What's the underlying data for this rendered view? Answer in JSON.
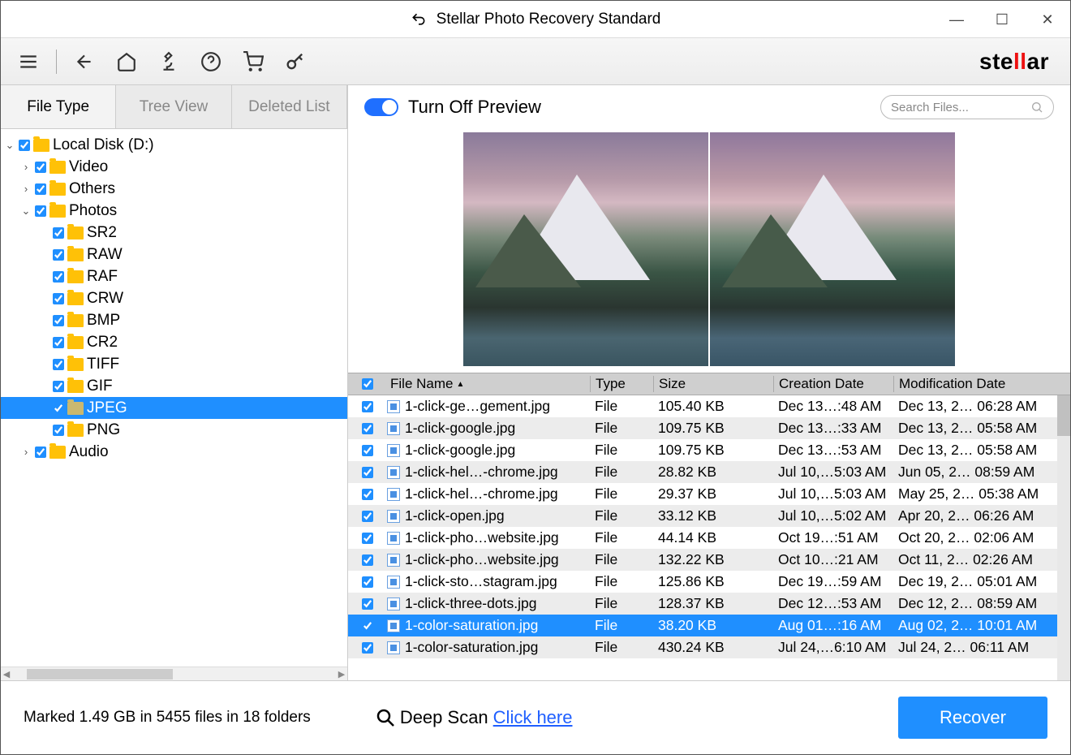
{
  "title": "Stellar Photo Recovery Standard",
  "brand": {
    "pre": "ste",
    "mid": "ll",
    "post": "ar"
  },
  "tabs": [
    "File Type",
    "Tree View",
    "Deleted List"
  ],
  "tree": {
    "root": "Local Disk (D:)",
    "items": [
      "Video",
      "Others",
      "Photos",
      "Audio"
    ],
    "photos_children": [
      "SR2",
      "RAW",
      "RAF",
      "CRW",
      "BMP",
      "CR2",
      "TIFF",
      "GIF",
      "JPEG",
      "PNG"
    ]
  },
  "toggle_label": "Turn Off Preview",
  "search_placeholder": "Search Files...",
  "columns": [
    "File Name",
    "Type",
    "Size",
    "Creation Date",
    "Modification Date"
  ],
  "files": [
    {
      "name": "1-click-ge…gement.jpg",
      "type": "File",
      "size": "105.40 KB",
      "cdate": "Dec 13…:48 AM",
      "mdate": "Dec 13, 2… 06:28 AM"
    },
    {
      "name": "1-click-google.jpg",
      "type": "File",
      "size": "109.75 KB",
      "cdate": "Dec 13…:33 AM",
      "mdate": "Dec 13, 2… 05:58 AM"
    },
    {
      "name": "1-click-google.jpg",
      "type": "File",
      "size": "109.75 KB",
      "cdate": "Dec 13…:53 AM",
      "mdate": "Dec 13, 2… 05:58 AM"
    },
    {
      "name": "1-click-hel…-chrome.jpg",
      "type": "File",
      "size": "28.82 KB",
      "cdate": "Jul 10,…5:03 AM",
      "mdate": "Jun 05, 2… 08:59 AM"
    },
    {
      "name": "1-click-hel…-chrome.jpg",
      "type": "File",
      "size": "29.37 KB",
      "cdate": "Jul 10,…5:03 AM",
      "mdate": "May 25, 2… 05:38 AM"
    },
    {
      "name": "1-click-open.jpg",
      "type": "File",
      "size": "33.12 KB",
      "cdate": "Jul 10,…5:02 AM",
      "mdate": "Apr 20, 2… 06:26 AM"
    },
    {
      "name": "1-click-pho…website.jpg",
      "type": "File",
      "size": "44.14 KB",
      "cdate": "Oct 19…:51 AM",
      "mdate": "Oct 20, 2… 02:06 AM"
    },
    {
      "name": "1-click-pho…website.jpg",
      "type": "File",
      "size": "132.22 KB",
      "cdate": "Oct 10…:21 AM",
      "mdate": "Oct 11, 2… 02:26 AM"
    },
    {
      "name": "1-click-sto…stagram.jpg",
      "type": "File",
      "size": "125.86 KB",
      "cdate": "Dec 19…:59 AM",
      "mdate": "Dec 19, 2… 05:01 AM"
    },
    {
      "name": "1-click-three-dots.jpg",
      "type": "File",
      "size": "128.37 KB",
      "cdate": "Dec 12…:53 AM",
      "mdate": "Dec 12, 2… 08:59 AM"
    },
    {
      "name": "1-color-saturation.jpg",
      "type": "File",
      "size": "38.20 KB",
      "cdate": "Aug 01…:16 AM",
      "mdate": "Aug 02, 2… 10:01 AM",
      "selected": true
    },
    {
      "name": "1-color-saturation.jpg",
      "type": "File",
      "size": "430.24 KB",
      "cdate": "Jul 24,…6:10 AM",
      "mdate": "Jul 24, 2… 06:11 AM"
    }
  ],
  "footer": {
    "status": "Marked 1.49 GB in 5455 files in 18 folders",
    "deep_label": "Deep Scan",
    "deep_link": "Click here",
    "recover": "Recover"
  }
}
